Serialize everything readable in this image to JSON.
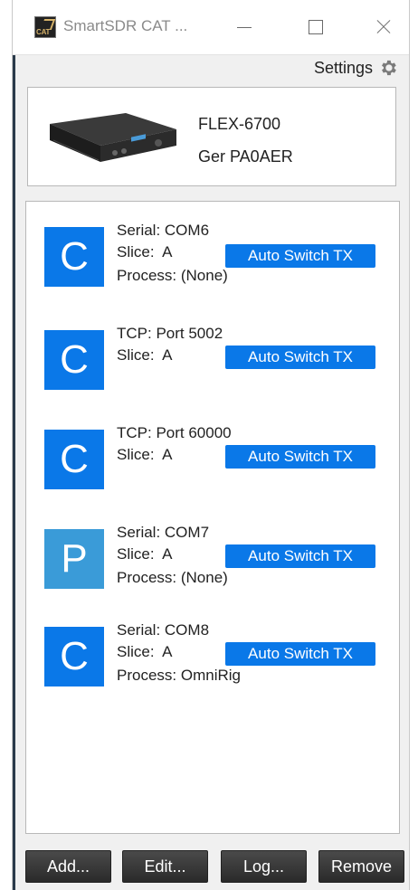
{
  "window": {
    "title": "SmartSDR CAT ...",
    "icon_text": "CAT",
    "icon": "app-icon"
  },
  "toolbar": {
    "settings_label": "Settings",
    "settings_icon": "gear-icon"
  },
  "radio": {
    "model": "FLEX-6700",
    "owner": "Ger PA0AER"
  },
  "clients": [
    {
      "letter": "C",
      "color": "#0a78e8",
      "line1": "Serial: COM6",
      "line2": "Slice:  A",
      "line3": "Process: (None)",
      "button": "Auto Switch TX"
    },
    {
      "letter": "C",
      "color": "#0a78e8",
      "line1": "TCP: Port 5002",
      "line2": "Slice:  A",
      "line3": "",
      "button": "Auto Switch TX"
    },
    {
      "letter": "C",
      "color": "#0a78e8",
      "line1": "TCP: Port 60000",
      "line2": "Slice:  A",
      "line3": "",
      "button": "Auto Switch TX"
    },
    {
      "letter": "P",
      "color": "#3a9bd8",
      "line1": "Serial: COM7",
      "line2": "Slice:  A",
      "line3": "Process: (None)",
      "button": "Auto Switch TX"
    },
    {
      "letter": "C",
      "color": "#0a78e8",
      "line1": "Serial: COM8",
      "line2": "Slice:  A",
      "line3": "Process: OmniRig",
      "button": "Auto Switch TX"
    }
  ],
  "actions": {
    "add": "Add...",
    "edit": "Edit...",
    "log": "Log...",
    "remove": "Remove"
  }
}
